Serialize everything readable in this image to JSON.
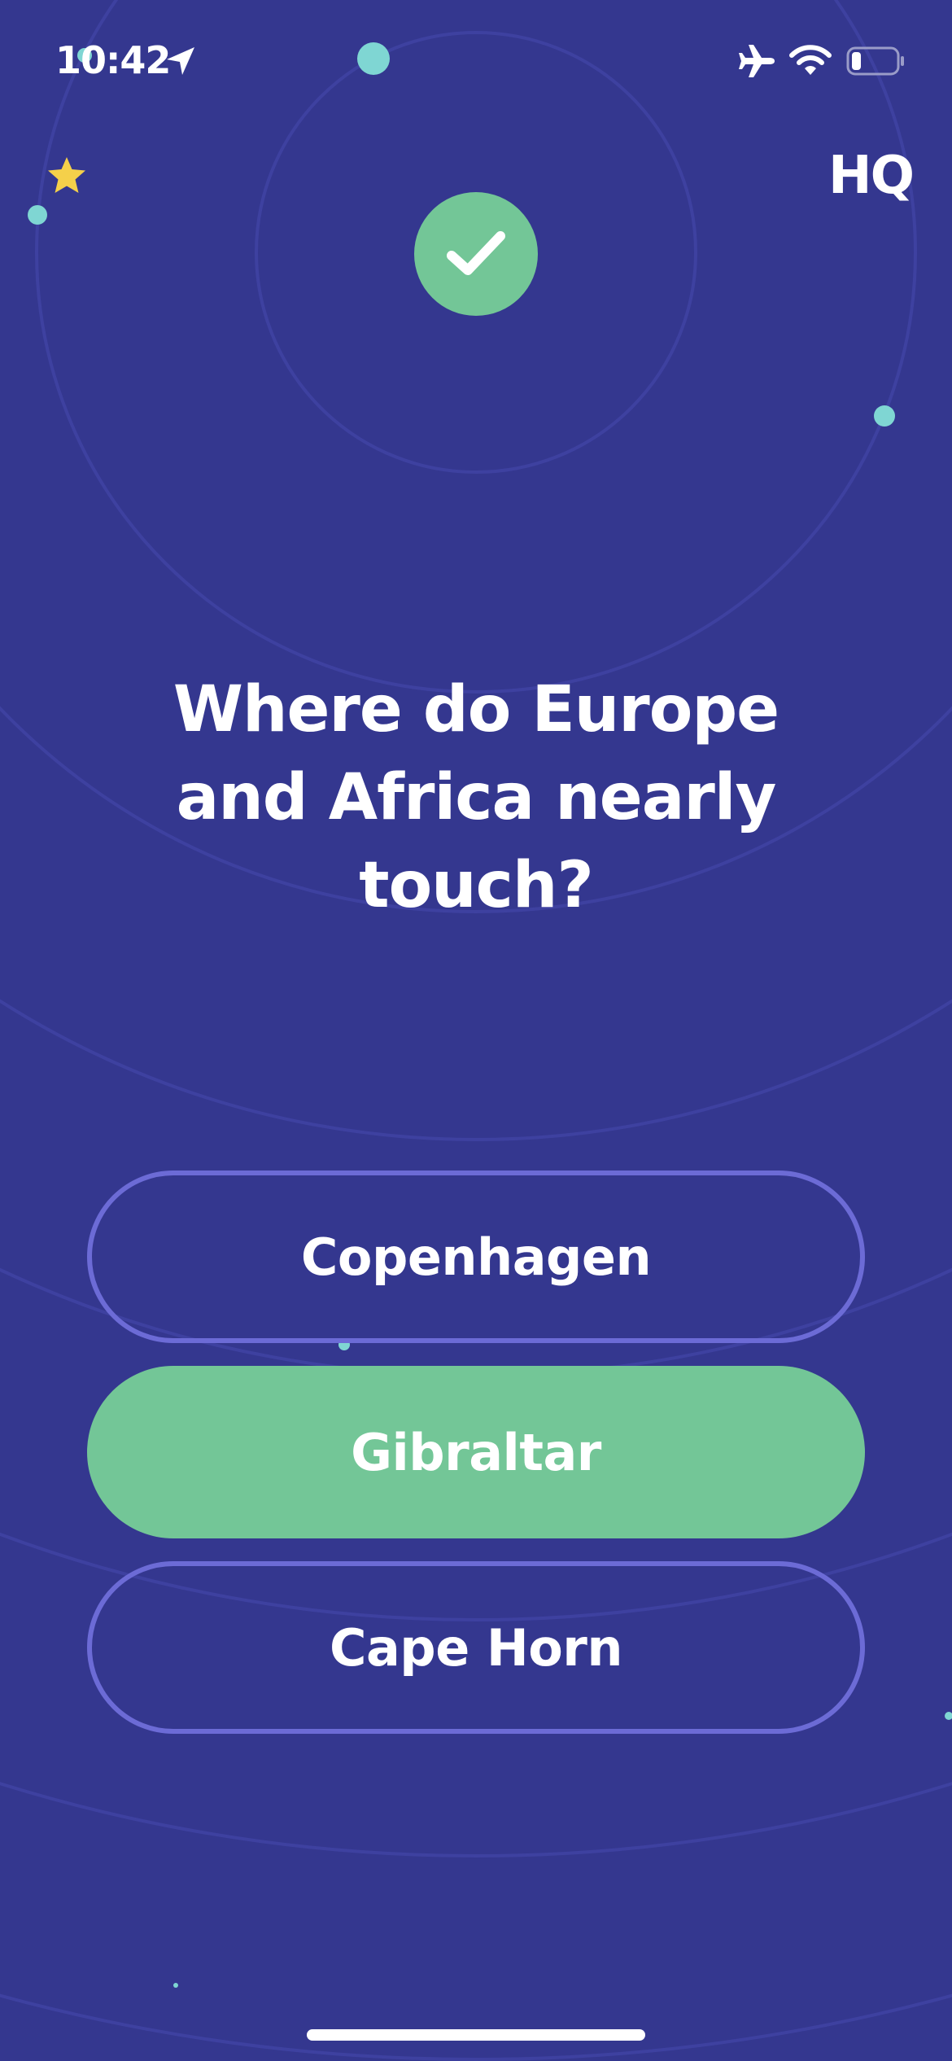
{
  "status_bar": {
    "time": "10:42",
    "icons": [
      "location-arrow-icon",
      "airplane-icon",
      "wifi-icon",
      "battery-icon"
    ],
    "battery_level": 0.2
  },
  "brand": {
    "logo_text": "HQ"
  },
  "result": {
    "icon": "checkmark-icon",
    "state": "correct"
  },
  "question": {
    "text": "Where do Europe and Africa nearly touch?"
  },
  "answers": [
    {
      "label": "Copenhagen",
      "state": "unselected"
    },
    {
      "label": "Gibraltar",
      "state": "correct"
    },
    {
      "label": "Cape Horn",
      "state": "unselected"
    }
  ],
  "colors": {
    "background": "#34378f",
    "correct_green": "#73c697",
    "outline_purple": "#6c6bd6",
    "dot_teal": "#7fd6d3",
    "star_yellow": "#f5d04a",
    "text": "#ffffff"
  }
}
